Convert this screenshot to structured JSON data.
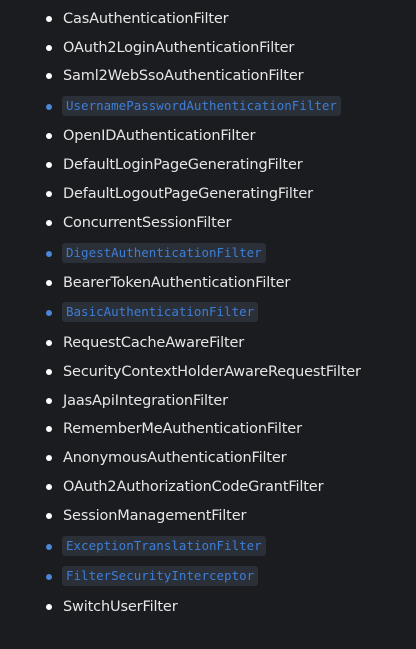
{
  "filters": [
    {
      "label": "CasAuthenticationFilter",
      "code": false
    },
    {
      "label": "OAuth2LoginAuthenticationFilter",
      "code": false
    },
    {
      "label": "Saml2WebSsoAuthenticationFilter",
      "code": false
    },
    {
      "label": "UsernamePasswordAuthenticationFilter",
      "code": true
    },
    {
      "label": "OpenIDAuthenticationFilter",
      "code": false
    },
    {
      "label": "DefaultLoginPageGeneratingFilter",
      "code": false
    },
    {
      "label": "DefaultLogoutPageGeneratingFilter",
      "code": false
    },
    {
      "label": "ConcurrentSessionFilter",
      "code": false
    },
    {
      "label": "DigestAuthenticationFilter",
      "code": true
    },
    {
      "label": "BearerTokenAuthenticationFilter",
      "code": false
    },
    {
      "label": "BasicAuthenticationFilter",
      "code": true
    },
    {
      "label": "RequestCacheAwareFilter",
      "code": false
    },
    {
      "label": "SecurityContextHolderAwareRequestFilter",
      "code": false
    },
    {
      "label": "JaasApiIntegrationFilter",
      "code": false
    },
    {
      "label": "RememberMeAuthenticationFilter",
      "code": false
    },
    {
      "label": "AnonymousAuthenticationFilter",
      "code": false
    },
    {
      "label": "OAuth2AuthorizationCodeGrantFilter",
      "code": false
    },
    {
      "label": "SessionManagementFilter",
      "code": false
    },
    {
      "label": "ExceptionTranslationFilter",
      "code": true
    },
    {
      "label": "FilterSecurityInterceptor",
      "code": true
    },
    {
      "label": "SwitchUserFilter",
      "code": false
    }
  ]
}
